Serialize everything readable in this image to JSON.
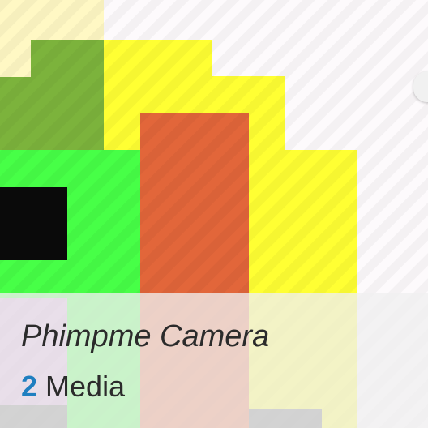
{
  "album": {
    "name": "Phimpme Camera",
    "count": "2",
    "count_label": "Media"
  },
  "colors": {
    "count_accent": "#1f7fc0",
    "overlay": "#f0f0f0"
  }
}
